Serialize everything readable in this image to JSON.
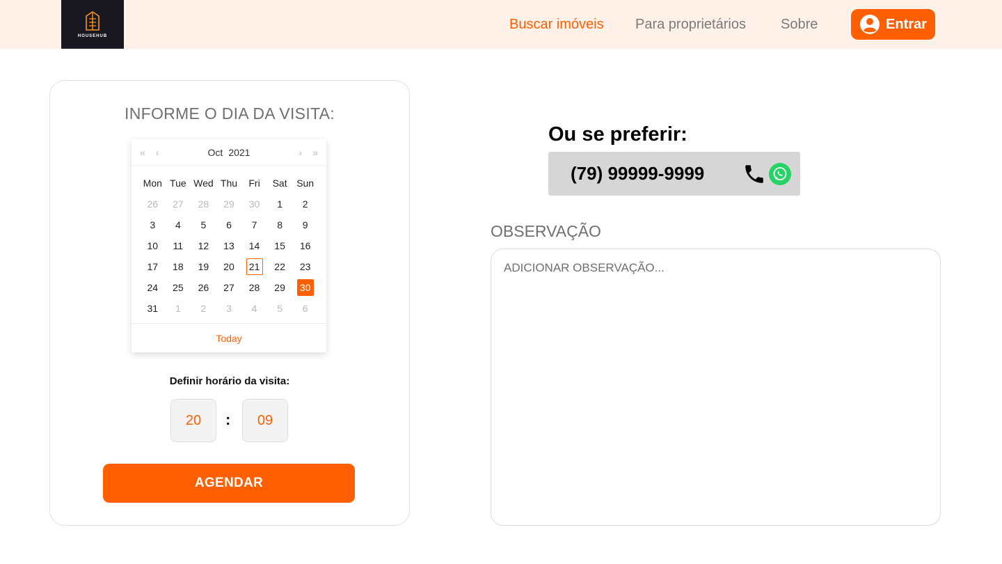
{
  "header": {
    "logo_text": "HOUSEHUB",
    "nav": [
      {
        "label": "Buscar imóveis",
        "active": true
      },
      {
        "label": "Para proprietários",
        "active": false
      },
      {
        "label": "Sobre",
        "active": false
      }
    ],
    "login_label": "Entrar"
  },
  "visit": {
    "title": "INFORME O DIA DA VISITA:",
    "calendar": {
      "month": "Oct",
      "year": "2021",
      "nav_prev_year": "«",
      "nav_prev_month": "‹",
      "nav_next_month": "›",
      "nav_next_year": "»",
      "weekdays": [
        "Mon",
        "Tue",
        "Wed",
        "Thu",
        "Fri",
        "Sat",
        "Sun"
      ],
      "weeks": [
        [
          {
            "d": "26",
            "muted": true
          },
          {
            "d": "27",
            "muted": true
          },
          {
            "d": "28",
            "muted": true
          },
          {
            "d": "29",
            "muted": true
          },
          {
            "d": "30",
            "muted": true
          },
          {
            "d": "1"
          },
          {
            "d": "2"
          }
        ],
        [
          {
            "d": "3"
          },
          {
            "d": "4"
          },
          {
            "d": "5"
          },
          {
            "d": "6"
          },
          {
            "d": "7"
          },
          {
            "d": "8"
          },
          {
            "d": "9"
          }
        ],
        [
          {
            "d": "10"
          },
          {
            "d": "11"
          },
          {
            "d": "12"
          },
          {
            "d": "13"
          },
          {
            "d": "14"
          },
          {
            "d": "15"
          },
          {
            "d": "16"
          }
        ],
        [
          {
            "d": "17"
          },
          {
            "d": "18"
          },
          {
            "d": "19"
          },
          {
            "d": "20"
          },
          {
            "d": "21",
            "today": true
          },
          {
            "d": "22"
          },
          {
            "d": "23"
          }
        ],
        [
          {
            "d": "24"
          },
          {
            "d": "25"
          },
          {
            "d": "26"
          },
          {
            "d": "27"
          },
          {
            "d": "28"
          },
          {
            "d": "29"
          },
          {
            "d": "30",
            "selected": true
          }
        ],
        [
          {
            "d": "31"
          },
          {
            "d": "1",
            "muted": true
          },
          {
            "d": "2",
            "muted": true
          },
          {
            "d": "3",
            "muted": true
          },
          {
            "d": "4",
            "muted": true
          },
          {
            "d": "5",
            "muted": true
          },
          {
            "d": "6",
            "muted": true
          }
        ]
      ],
      "today_label": "Today"
    },
    "time_label": "Definir horário da visita:",
    "hour": "20",
    "minute": "09",
    "separator": ":",
    "submit_label": "AGENDAR"
  },
  "contact": {
    "title": "Ou se preferir:",
    "phone": "(79) 99999-9999"
  },
  "observation": {
    "label": "OBSERVAÇÃO",
    "placeholder": "ADICIONAR OBSERVAÇÃO..."
  },
  "colors": {
    "accent": "#ff5f00",
    "header_bg": "#fff0e8",
    "logo_bg": "#191820",
    "whatsapp": "#25d366"
  }
}
